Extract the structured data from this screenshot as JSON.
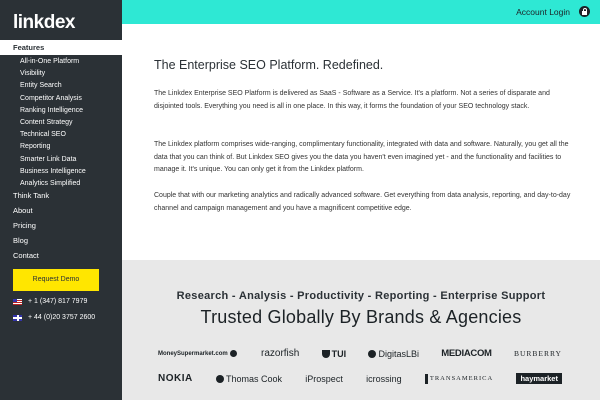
{
  "sidebar": {
    "logo": "linkdex",
    "active_item": "Features",
    "sub_items": [
      "All-in-One Platform",
      "Visibility",
      "Entity Search",
      "Competitor Analysis",
      "Ranking Intelligence",
      "Content Strategy",
      "Technical SEO",
      "Reporting",
      "Smarter Link Data",
      "Business Intelligence",
      "Analytics Simplified"
    ],
    "main_items": [
      "Think Tank",
      "About",
      "Pricing",
      "Blog",
      "Contact"
    ],
    "demo_button": "Request Demo",
    "phone_us": "+ 1 (347) 817 7979",
    "phone_uk": "+ 44 (0)20 3757 2600"
  },
  "topbar": {
    "account_label": "Account Login",
    "icon": "lock-icon"
  },
  "content": {
    "title": "The Enterprise SEO Platform. Redefined.",
    "paragraph_1": "The Linkdex Enterprise SEO Platform is delivered as SaaS - Software as a Service. It's a platform. Not a series of disparate and disjointed tools. Everything you need is all in one place. In this way, it forms the foundation of your SEO technology stack.",
    "paragraph_2": "The Linkdex platform comprises wide-ranging, complimentary functionality, integrated with data and software. Naturally, you get all the data that you can think of. But Linkdex SEO gives you the data you haven't even imagined yet - and the functionality and facilities to manage it. It's unique. You can only get it from the Linkdex platform.",
    "paragraph_3": "Couple that with our marketing analytics and radically advanced software. Get everything from data analysis, reporting, and day-to-day channel and campaign management and you have a magnificent competitive edge."
  },
  "trusted": {
    "tagline": "Research - Analysis - Productivity - Reporting - Enterprise Support",
    "headline": "Trusted Globally By Brands & Agencies",
    "logos_row_1": [
      "MoneySupermarket.com",
      "razorfish",
      "TUI",
      "DigitasLBi",
      "MEDIACOM",
      "BURBERRY"
    ],
    "logos_row_2": [
      "NOKIA",
      "Thomas Cook",
      "iProspect",
      "icrossing",
      "TRANSAMERICA",
      "haymarket"
    ]
  },
  "colors": {
    "sidebar_bg": "#2b3136",
    "topbar_bg": "#2ee8d4",
    "demo_button_bg": "#ffe600"
  }
}
